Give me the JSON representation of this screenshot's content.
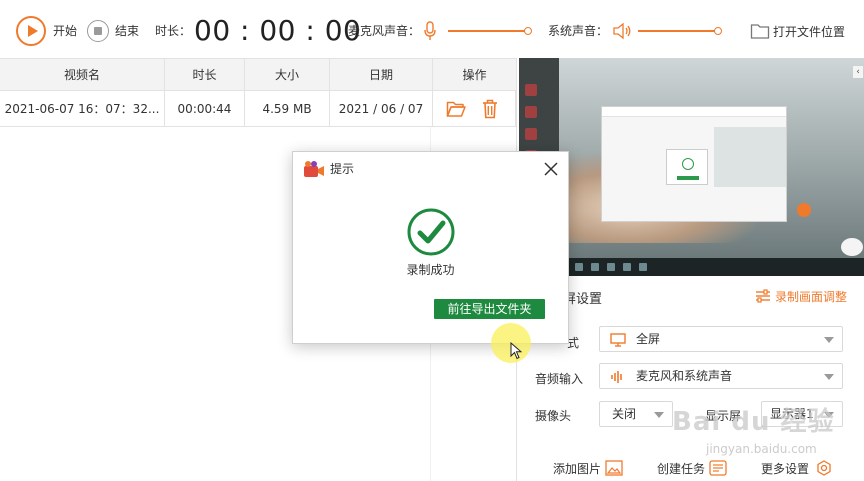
{
  "toolbar": {
    "start_label": "开始",
    "stop_label": "结束",
    "duration_label": "时长：",
    "timer": "00 : 00 : 00",
    "mic_label": "麦克风声音：",
    "system_label": "系统声音：",
    "open_folder_label": "打开文件位置",
    "mic_volume": 1.0,
    "system_volume": 1.0,
    "accent_color": "#f07a2c"
  },
  "table": {
    "headers": [
      "视频名",
      "时长",
      "大小",
      "日期",
      "操作"
    ],
    "rows": [
      {
        "name": "2021-06-07 16：07：32...",
        "duration": "00:00:44",
        "size": "4.59 MB",
        "date": "2021 / 06 / 07",
        "actions": [
          "folder-icon",
          "trash-icon"
        ]
      }
    ]
  },
  "settings": {
    "header_left": "屏设置",
    "header_right": "录制画面调整",
    "mode_label": "式",
    "mode_value": "全屏",
    "audio_label": "音频输入",
    "audio_value": "麦克风和系统声音",
    "camera_label": "摄像头",
    "camera_value": "关闭",
    "display_label": "显示屏",
    "display_value": "显示器1",
    "add_image_label": "添加图片",
    "create_task_label": "创建任务",
    "more_settings_label": "更多设置"
  },
  "dialog": {
    "title": "提示",
    "message": "录制成功",
    "button_label": "前往导出文件夹",
    "button_color": "#1e8a3f"
  },
  "watermark": {
    "brand": "Bai du 经验",
    "url": "jingyan.baidu.com"
  }
}
